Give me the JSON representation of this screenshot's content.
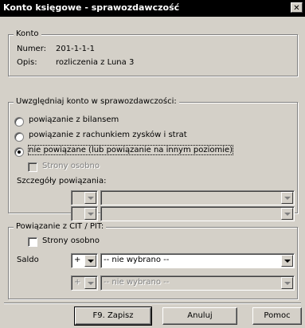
{
  "window": {
    "title": "Konto księgowe - sprawozdawczość",
    "close_glyph": "✕"
  },
  "konto": {
    "group_label": "Konto",
    "numer_label": "Numer:",
    "numer_value": "201-1-1-1",
    "opis_label": "Opis:",
    "opis_value": "rozliczenia z Luna 3"
  },
  "sprawozdawczosc": {
    "group_label": "Uwzględniaj konto w sprawozdawczości:",
    "options": [
      {
        "label": "powiązanie z bilansem",
        "selected": false
      },
      {
        "label": "powiązanie z rachunkiem zysków i strat",
        "selected": false
      },
      {
        "label": "nie powiązane (lub powiązanie na innym poziomie)",
        "selected": true
      }
    ],
    "strony_osobno_label": "Strony osobno",
    "szczegoly_label": "Szczegóły powiązania:"
  },
  "cit_pit": {
    "group_label": "Powiązanie z CIT / PIT:",
    "strony_osobno_label": "Strony osobno",
    "saldo_label": "Saldo",
    "sign_value": "+",
    "selection_value": "-- nie wybrano --",
    "sign_value_2": "+",
    "selection_value_2": "-- nie wybrano --"
  },
  "buttons": {
    "save": "F9. Zapisz",
    "cancel": "Anuluj",
    "help": "Pomoc"
  }
}
